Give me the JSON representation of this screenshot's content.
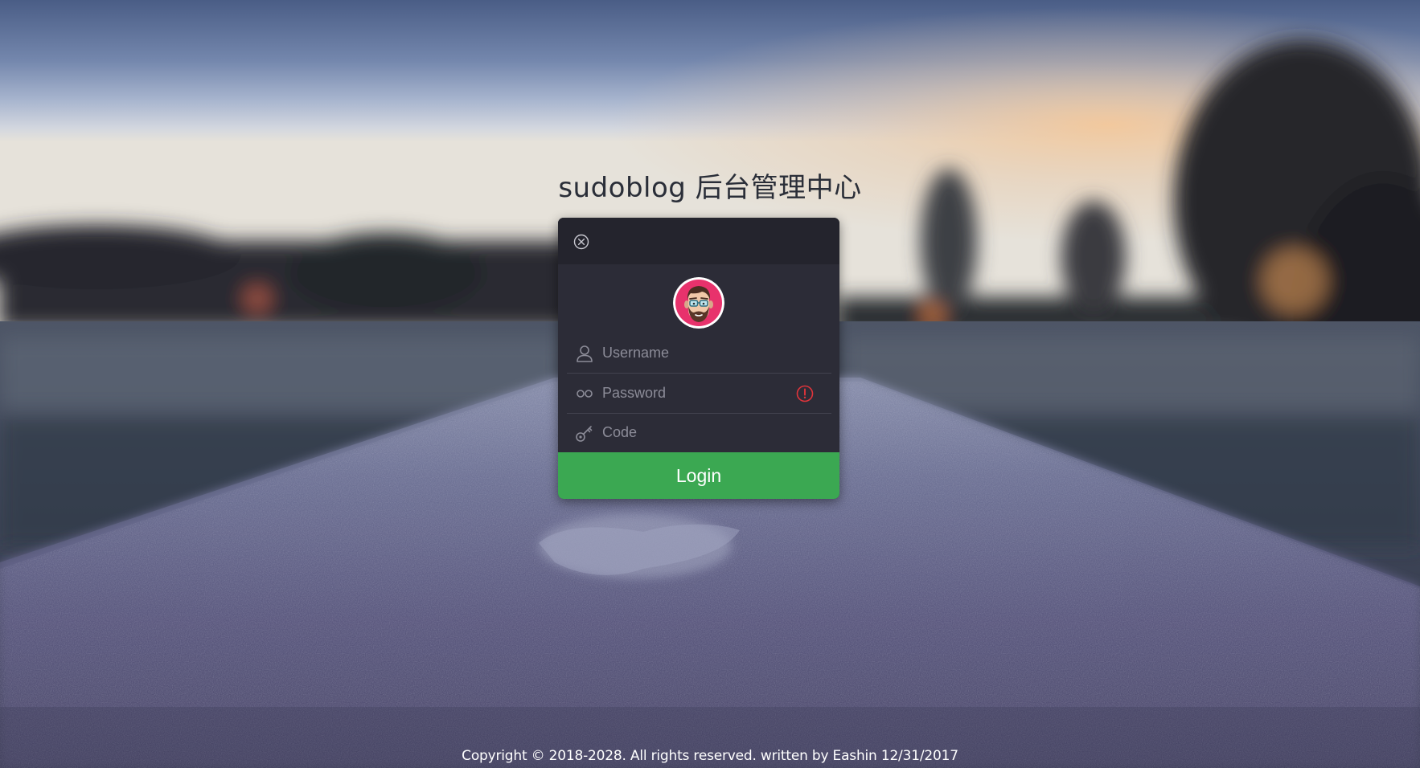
{
  "page": {
    "title": "sudoblog 后台管理中心",
    "footer": "Copyright © 2018-2028. All rights reserved. written by Eashin 12/31/2017"
  },
  "login_card": {
    "close_icon": "close-circle-icon",
    "avatar_icon": "bearded-man-with-glasses-avatar",
    "fields": {
      "username": {
        "placeholder": "Username",
        "value": "",
        "icon": "user-icon"
      },
      "password": {
        "placeholder": "Password",
        "value": "",
        "icon": "password-dots-icon",
        "status_icon": "error-exclamation-icon"
      },
      "code": {
        "placeholder": "Code",
        "value": "",
        "icon": "key-icon"
      }
    },
    "login_label": "Login"
  },
  "colors": {
    "card_background": "#2c2c37",
    "card_header": "#24242d",
    "login_button": "#3ba852",
    "error_accent": "#e0343b",
    "avatar_ring": "#e8326c"
  }
}
